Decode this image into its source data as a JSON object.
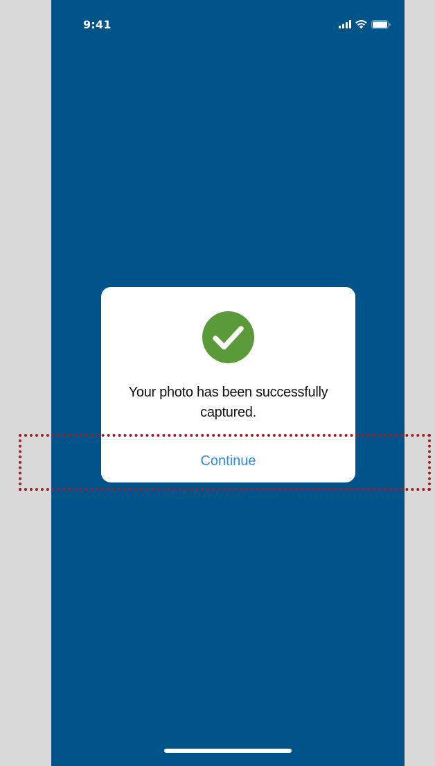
{
  "colors": {
    "page_background": "#d8d8d8",
    "screen_background": "#00548a",
    "dialog_background": "#ffffff",
    "success_green": "#5a9a38",
    "link_blue": "#2b8be3",
    "divider": "#e4e4e4",
    "home_indicator": "#ffffff",
    "annotation_red": "#a01c24"
  },
  "status_bar": {
    "time": "9:41",
    "icons": [
      "signal-icon",
      "wifi-icon",
      "battery-icon"
    ]
  },
  "dialog": {
    "icon": "check-circle-icon",
    "message": "Your photo has been successfully captured.",
    "continue_label": "Continue"
  }
}
